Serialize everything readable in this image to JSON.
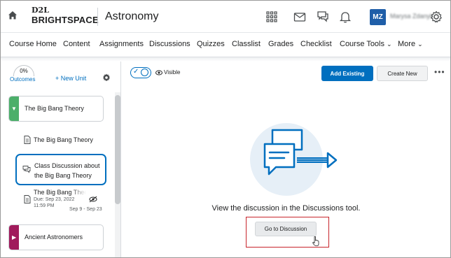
{
  "header": {
    "logo_top": "D2L",
    "logo_bottom": "BRIGHTSPACE",
    "course_title": "Astronomy",
    "avatar_initials": "MZ",
    "user_name": "Marysa Zdanyk"
  },
  "nav": {
    "items": [
      {
        "label": "Course Home"
      },
      {
        "label": "Content"
      },
      {
        "label": "Assignments"
      },
      {
        "label": "Discussions"
      },
      {
        "label": "Quizzes"
      },
      {
        "label": "Classlist"
      },
      {
        "label": "Grades"
      },
      {
        "label": "Checklist"
      },
      {
        "label": "Course Tools"
      },
      {
        "label": "More"
      }
    ]
  },
  "sidebar": {
    "outcomes_percent": "0%",
    "outcomes_label": "Outcomes",
    "new_unit_label": "+ New Unit",
    "units": [
      {
        "label": "The Big Bang Theory",
        "color": "#4caf6a",
        "expanded": true
      },
      {
        "label": "Ancient Astronomers",
        "color": "#a01b5c",
        "expanded": false
      }
    ],
    "topics": [
      {
        "label": "The Big Bang Theory"
      },
      {
        "label": "Class Discussion about the Big Bang Theory"
      },
      {
        "label": "The Big Bang Theory",
        "due": "Due: Sep 23, 2022 11:59 PM",
        "dates": "Sep 9 - Sep 23"
      }
    ]
  },
  "main": {
    "visibility_label": "Visible",
    "add_existing_label": "Add Existing",
    "create_new_label": "Create New",
    "empty_message": "View the discussion in the Discussions tool.",
    "goto_button_label": "Go to Discussion"
  },
  "colors": {
    "primary": "#006fbf",
    "highlight": "#c8242b"
  }
}
